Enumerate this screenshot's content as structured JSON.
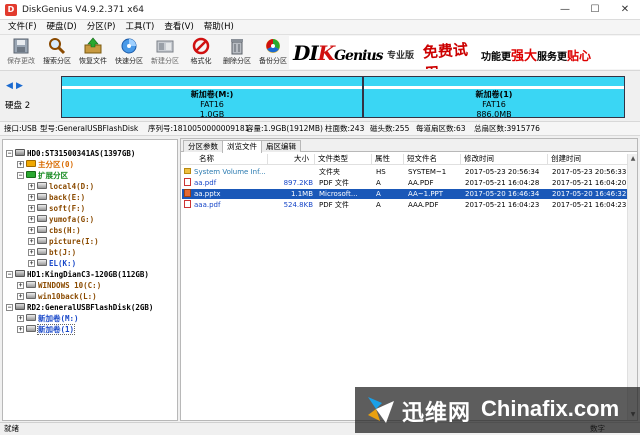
{
  "window": {
    "title": "DiskGenius V4.9.2.371 x64",
    "icon_glyph": "D",
    "minimize": "—",
    "maximize": "☐",
    "close": "✕"
  },
  "menu": [
    "文件(F)",
    "硬盘(D)",
    "分区(P)",
    "工具(T)",
    "查看(V)",
    "帮助(H)"
  ],
  "toolbar": {
    "save": "保存更改",
    "search": "搜索分区",
    "recover": "恢复文件",
    "quick": "快速分区",
    "new": "新建分区",
    "format": "格式化",
    "delete": "删除分区",
    "backup": "备份分区"
  },
  "banner": {
    "logo_a": "DI",
    "logo_b": "K",
    "logo_c": "Genius",
    "edition": "专业版",
    "free": "免费试用",
    "upgrade_a": "功能更",
    "upgrade_b": "强大",
    "upgrade_c": "服务更",
    "upgrade_d": "贴心"
  },
  "diskbar": {
    "nav_left": "◀",
    "nav_right": "▶",
    "disk_label": "硬盘 2",
    "partitions": [
      {
        "name": "新加卷(M:)",
        "fs": "FAT16",
        "size": "1.0GB"
      },
      {
        "name": "新加卷(1)",
        "fs": "FAT16",
        "size": "886.0MB"
      }
    ]
  },
  "info": {
    "interface": "接口:USB",
    "model": "型号:GeneralUSBFlashDisk",
    "serial": "序列号:1810050000009181",
    "capacity": "容量:1.9GB(1912MB)",
    "cylinders": "柱面数:243",
    "heads": "磁头数:255",
    "sectors_per_track": "每道扇区数:63",
    "total_sectors": "总扇区数:3915776"
  },
  "tree": [
    {
      "label": "HD0:ST31500341AS(1397GB)",
      "exp": "−"
    },
    {
      "label": "主分区(0)",
      "exp": "+"
    },
    {
      "label": "扩展分区",
      "exp": "−"
    },
    {
      "label": "local4(D:)",
      "exp": "+"
    },
    {
      "label": "back(E:)",
      "exp": "+"
    },
    {
      "label": "soft(F:)",
      "exp": "+"
    },
    {
      "label": "yumofa(G:)",
      "exp": "+"
    },
    {
      "label": "cbs(H:)",
      "exp": "+"
    },
    {
      "label": "picture(I:)",
      "exp": "+"
    },
    {
      "label": "bt(J:)",
      "exp": "+"
    },
    {
      "label": "EL(K:)",
      "exp": "+"
    },
    {
      "label": "HD1:KingDianC3-120GB(112GB)",
      "exp": "−"
    },
    {
      "label": "WINDOWS 10(C:)",
      "exp": "+"
    },
    {
      "label": "win10back(L:)",
      "exp": "+"
    },
    {
      "label": "RD2:GeneralUSBFlashDisk(2GB)",
      "exp": "−"
    },
    {
      "label": "新加卷(M:)",
      "exp": "+"
    },
    {
      "label": "新加卷(1)",
      "exp": "+"
    }
  ],
  "tabs": [
    "分区参数",
    "浏览文件",
    "扇区编辑"
  ],
  "columns": {
    "name": "名称",
    "size": "大小",
    "type": "文件类型",
    "attr": "属性",
    "short": "短文件名",
    "modified": "修改时间",
    "created": "创建时间"
  },
  "files": [
    {
      "name": "System Volume Inf...",
      "size": "",
      "type": "文件夹",
      "attr": "HS",
      "short": "SYSTEM~1",
      "modified": "2017-05-23 20:56:34",
      "created": "2017-05-23 20:56:33"
    },
    {
      "name": "aa.pdf",
      "size": "897.2KB",
      "type": "PDF 文件",
      "attr": "A",
      "short": "AA.PDF",
      "modified": "2017-05-21 16:04:28",
      "created": "2017-05-21 16:04:20"
    },
    {
      "name": "aa.pptx",
      "size": "1.1MB",
      "type": "Microsoft...",
      "attr": "A",
      "short": "AA~1.PPT",
      "modified": "2017-05-20 16:46:34",
      "created": "2017-05-20 16:46:32"
    },
    {
      "name": "aaa.pdf",
      "size": "524.8KB",
      "type": "PDF 文件",
      "attr": "A",
      "short": "AAA.PDF",
      "modified": "2017-05-21 16:04:23",
      "created": "2017-05-21 16:04:23"
    }
  ],
  "status": {
    "ready": "就绪",
    "right": "数字"
  },
  "watermark": {
    "cn": "迅维网",
    "en": "Chinafix.com"
  }
}
